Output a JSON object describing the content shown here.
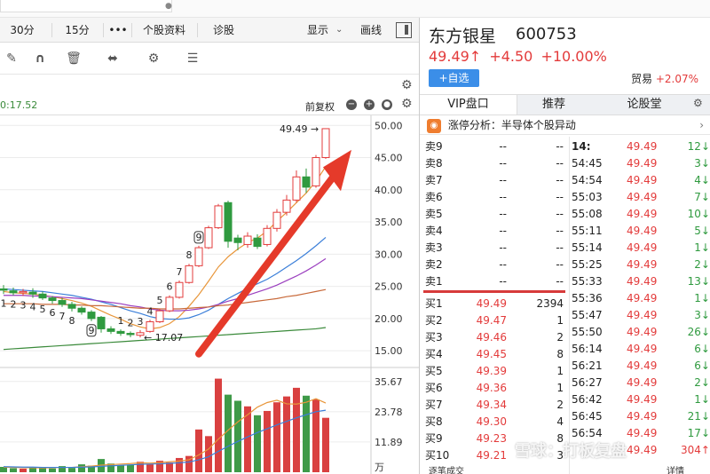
{
  "tabs": [
    "30分",
    "15分",
    "•••",
    "个股资料",
    "诊股",
    "显示",
    "画线"
  ],
  "subbar": {
    "time": "0:17.52",
    "label": "前复权"
  },
  "stock": {
    "name": "东方银星",
    "code": "600753",
    "price": "49.49↑",
    "change": "+4.50",
    "pct": "+10.00%",
    "add_btn": "+自选",
    "trade_label": "贸易",
    "trade_pct": "+2.07%"
  },
  "right_tabs": [
    "VIP盘口",
    "推荐",
    "论股堂"
  ],
  "news": "涨停分析：半导体个股异动",
  "sell_book": [
    {
      "label": "卖9",
      "price": "--",
      "vol": "--"
    },
    {
      "label": "卖8",
      "price": "--",
      "vol": "--"
    },
    {
      "label": "卖7",
      "price": "--",
      "vol": "--"
    },
    {
      "label": "卖6",
      "price": "--",
      "vol": "--"
    },
    {
      "label": "卖5",
      "price": "--",
      "vol": "--"
    },
    {
      "label": "卖4",
      "price": "--",
      "vol": "--"
    },
    {
      "label": "卖3",
      "price": "--",
      "vol": "--"
    },
    {
      "label": "卖2",
      "price": "--",
      "vol": "--"
    },
    {
      "label": "卖1",
      "price": "--",
      "vol": "--"
    }
  ],
  "buy_book": [
    {
      "label": "买1",
      "price": "49.49",
      "vol": "2394"
    },
    {
      "label": "买2",
      "price": "49.47",
      "vol": "1"
    },
    {
      "label": "买3",
      "price": "49.46",
      "vol": "2"
    },
    {
      "label": "买4",
      "price": "49.45",
      "vol": "8"
    },
    {
      "label": "买5",
      "price": "49.39",
      "vol": "1"
    },
    {
      "label": "买6",
      "price": "49.36",
      "vol": "1"
    },
    {
      "label": "买7",
      "price": "49.34",
      "vol": "2"
    },
    {
      "label": "买8",
      "price": "49.30",
      "vol": "4"
    },
    {
      "label": "买9",
      "price": "49.23",
      "vol": "8"
    },
    {
      "label": "买10",
      "price": "49.21",
      "vol": "3"
    }
  ],
  "ticks": [
    {
      "t": "14:",
      "p": "49.49",
      "v": "12↓",
      "c": "green"
    },
    {
      "t": "54:45",
      "p": "49.49",
      "v": "3↓",
      "c": "green"
    },
    {
      "t": "54:54",
      "p": "49.49",
      "v": "4↓",
      "c": "green"
    },
    {
      "t": "55:03",
      "p": "49.49",
      "v": "7↓",
      "c": "green"
    },
    {
      "t": "55:08",
      "p": "49.49",
      "v": "10↓",
      "c": "green"
    },
    {
      "t": "55:11",
      "p": "49.49",
      "v": "5↓",
      "c": "green"
    },
    {
      "t": "55:14",
      "p": "49.49",
      "v": "1↓",
      "c": "green"
    },
    {
      "t": "55:25",
      "p": "49.49",
      "v": "2↓",
      "c": "green"
    },
    {
      "t": "55:33",
      "p": "49.49",
      "v": "13↓",
      "c": "green"
    },
    {
      "t": "55:36",
      "p": "49.49",
      "v": "1↓",
      "c": "green"
    },
    {
      "t": "55:47",
      "p": "49.49",
      "v": "3↓",
      "c": "green"
    },
    {
      "t": "55:50",
      "p": "49.49",
      "v": "26↓",
      "c": "green"
    },
    {
      "t": "56:14",
      "p": "49.49",
      "v": "6↓",
      "c": "green"
    },
    {
      "t": "56:21",
      "p": "49.49",
      "v": "6↓",
      "c": "green"
    },
    {
      "t": "56:27",
      "p": "49.49",
      "v": "2↓",
      "c": "green"
    },
    {
      "t": "56:42",
      "p": "49.49",
      "v": "1↓",
      "c": "green"
    },
    {
      "t": "56:45",
      "p": "49.49",
      "v": "21↓",
      "c": "green"
    },
    {
      "t": "56:54",
      "p": "49.49",
      "v": "17↓",
      "c": "green"
    },
    {
      "t": "",
      "p": "49.49",
      "v": "304↑",
      "c": "red"
    }
  ],
  "foot": {
    "left": "逐笔成交",
    "right": "详情"
  },
  "watermark": "雪球：打板复盘",
  "chart_data": {
    "type": "candlestick",
    "y_ticks": [
      50,
      45,
      40,
      35,
      30,
      25,
      20,
      15
    ],
    "ylim": [
      13.5,
      51
    ],
    "vol_ticks": [
      "35.67",
      "23.78",
      "11.89"
    ],
    "vol_unit": "万",
    "high_label": "49.49",
    "low_label": "17.07",
    "candles": [
      {
        "o": 24.6,
        "c": 24.4,
        "h": 25.2,
        "l": 23.8
      },
      {
        "o": 24.3,
        "c": 24.0,
        "h": 24.8,
        "l": 23.6
      },
      {
        "o": 24.0,
        "c": 24.2,
        "h": 24.6,
        "l": 23.5
      },
      {
        "o": 24.1,
        "c": 23.8,
        "h": 24.7,
        "l": 23.2
      },
      {
        "o": 23.8,
        "c": 23.2,
        "h": 24.2,
        "l": 22.9
      },
      {
        "o": 23.2,
        "c": 22.8,
        "h": 23.5,
        "l": 22.3
      },
      {
        "o": 22.8,
        "c": 22.2,
        "h": 23.2,
        "l": 21.8
      },
      {
        "o": 22.2,
        "c": 21.6,
        "h": 22.6,
        "l": 21.1
      },
      {
        "o": 21.6,
        "c": 21.0,
        "h": 21.9,
        "l": 20.6
      },
      {
        "o": 21.0,
        "c": 20.0,
        "h": 21.3,
        "l": 19.6
      },
      {
        "o": 20.2,
        "c": 18.4,
        "h": 20.4,
        "l": 17.8
      },
      {
        "o": 18.4,
        "c": 18.0,
        "h": 18.8,
        "l": 17.6
      },
      {
        "o": 18.0,
        "c": 17.7,
        "h": 18.3,
        "l": 17.3
      },
      {
        "o": 17.7,
        "c": 17.5,
        "h": 18.0,
        "l": 17.1
      },
      {
        "o": 17.4,
        "c": 17.8,
        "h": 18.2,
        "l": 17.07
      },
      {
        "o": 18.0,
        "c": 19.5,
        "h": 19.8,
        "l": 17.8
      },
      {
        "o": 19.5,
        "c": 21.2,
        "h": 21.5,
        "l": 19.3
      },
      {
        "o": 21.2,
        "c": 23.3,
        "h": 23.6,
        "l": 21.0
      },
      {
        "o": 23.3,
        "c": 25.6,
        "h": 25.9,
        "l": 23.1
      },
      {
        "o": 25.6,
        "c": 28.2,
        "h": 28.5,
        "l": 25.4
      },
      {
        "o": 28.2,
        "c": 31.0,
        "h": 31.3,
        "l": 28.0
      },
      {
        "o": 31.0,
        "c": 34.1,
        "h": 34.4,
        "l": 30.8
      },
      {
        "o": 34.1,
        "c": 37.5,
        "h": 37.8,
        "l": 33.9
      },
      {
        "o": 38.0,
        "c": 32.0,
        "h": 38.3,
        "l": 31.0
      },
      {
        "o": 32.5,
        "c": 31.8,
        "h": 33.0,
        "l": 30.6
      },
      {
        "o": 31.5,
        "c": 32.8,
        "h": 33.4,
        "l": 31.0
      },
      {
        "o": 32.5,
        "c": 31.2,
        "h": 33.1,
        "l": 30.8
      },
      {
        "o": 31.5,
        "c": 34.0,
        "h": 34.5,
        "l": 31.2
      },
      {
        "o": 34.0,
        "c": 36.5,
        "h": 37.0,
        "l": 33.5
      },
      {
        "o": 36.5,
        "c": 38.4,
        "h": 39.2,
        "l": 36.0
      },
      {
        "o": 38.4,
        "c": 42.0,
        "h": 43.0,
        "l": 38.0
      },
      {
        "o": 42.0,
        "c": 40.4,
        "h": 43.3,
        "l": 39.5
      },
      {
        "o": 40.6,
        "c": 45.0,
        "h": 45.4,
        "l": 40.3
      },
      {
        "o": 45.0,
        "c": 49.49,
        "h": 49.49,
        "l": 44.8
      }
    ],
    "ma_series": [
      {
        "color": "#e8963a",
        "values": [
          24.2,
          24.0,
          23.9,
          23.8,
          23.6,
          23.4,
          23.1,
          22.8,
          22.4,
          21.9,
          21.2,
          20.5,
          19.9,
          19.2,
          18.7,
          18.4,
          18.6,
          19.2,
          20.3,
          21.9,
          23.7,
          25.8,
          28.0,
          29.6,
          30.8,
          31.8,
          32.5,
          33.6,
          35.1,
          36.5,
          38.0,
          39.5,
          41.3,
          43.6
        ]
      },
      {
        "color": "#3b7fd9",
        "values": [
          24.6,
          24.5,
          24.4,
          24.3,
          24.2,
          24.0,
          23.8,
          23.6,
          23.3,
          23.0,
          22.6,
          22.2,
          21.7,
          21.2,
          20.8,
          20.3,
          20.0,
          19.9,
          19.9,
          20.1,
          20.6,
          21.3,
          22.2,
          23.1,
          23.9,
          24.7,
          25.4,
          26.1,
          27.0,
          28.0,
          29.0,
          30.1,
          31.3,
          32.6
        ]
      },
      {
        "color": "#9b3fbf",
        "values": [
          23.6,
          23.6,
          23.6,
          23.5,
          23.5,
          23.4,
          23.3,
          23.2,
          23.1,
          22.9,
          22.7,
          22.5,
          22.3,
          22.0,
          21.8,
          21.5,
          21.3,
          21.2,
          21.2,
          21.3,
          21.5,
          21.8,
          22.2,
          22.7,
          23.1,
          23.6,
          24.1,
          24.6,
          25.2,
          25.9,
          26.6,
          27.4,
          28.3,
          29.3
        ]
      },
      {
        "color": "#c8693a",
        "values": [
          22.3,
          22.3,
          22.3,
          22.3,
          22.2,
          22.2,
          22.2,
          22.1,
          22.1,
          22.0,
          22.0,
          21.9,
          21.8,
          21.7,
          21.6,
          21.6,
          21.5,
          21.5,
          21.5,
          21.6,
          21.7,
          21.8,
          22.0,
          22.1,
          22.3,
          22.5,
          22.7,
          22.9,
          23.1,
          23.4,
          23.6,
          23.9,
          24.2,
          24.5
        ]
      },
      {
        "color": "#3a8a3a",
        "values": [
          15.2,
          15.3,
          15.4,
          15.5,
          15.6,
          15.7,
          15.8,
          15.9,
          16.0,
          16.1,
          16.2,
          16.3,
          16.4,
          16.5,
          16.6,
          16.7,
          16.8,
          16.9,
          17.0,
          17.1,
          17.2,
          17.3,
          17.4,
          17.5,
          17.6,
          17.7,
          17.8,
          17.9,
          18.0,
          18.1,
          18.2,
          18.3,
          18.4,
          18.6
        ]
      }
    ],
    "seq_labels": [
      {
        "i": 0,
        "t": "1",
        "pos": "below"
      },
      {
        "i": 1,
        "t": "2",
        "pos": "below"
      },
      {
        "i": 2,
        "t": "3",
        "pos": "below"
      },
      {
        "i": 3,
        "t": "4",
        "pos": "below"
      },
      {
        "i": 4,
        "t": "5",
        "pos": "below"
      },
      {
        "i": 5,
        "t": "6",
        "pos": "below"
      },
      {
        "i": 6,
        "t": "7",
        "pos": "below"
      },
      {
        "i": 7,
        "t": "8",
        "pos": "below"
      },
      {
        "i": 9,
        "t": "9",
        "pos": "below",
        "boxed": true
      },
      {
        "i": 12,
        "t": "1",
        "pos": "above"
      },
      {
        "i": 13,
        "t": "2",
        "pos": "above"
      },
      {
        "i": 14,
        "t": "3",
        "pos": "above"
      },
      {
        "i": 15,
        "t": "4",
        "pos": "above"
      },
      {
        "i": 16,
        "t": "5",
        "pos": "above"
      },
      {
        "i": 17,
        "t": "6",
        "pos": "above"
      },
      {
        "i": 18,
        "t": "7",
        "pos": "above"
      },
      {
        "i": 19,
        "t": "8",
        "pos": "above"
      },
      {
        "i": 20,
        "t": "9",
        "pos": "above",
        "boxed": true
      }
    ],
    "volumes": [
      2.1,
      1.6,
      1.4,
      2.0,
      1.8,
      1.5,
      2.4,
      1.7,
      3.1,
      2.6,
      5.2,
      3.4,
      2.8,
      3.0,
      4.1,
      3.3,
      4.5,
      3.8,
      5.6,
      6.4,
      16.8,
      14.2,
      36.8,
      30.5,
      28.1,
      25.9,
      22.4,
      24.1,
      27.5,
      29.8,
      33.2,
      30.1,
      28.6,
      21.4
    ],
    "vol_ylim": [
      0,
      37
    ],
    "vol_ma": [
      {
        "color": "#e8963a",
        "values": [
          2.0,
          1.9,
          1.8,
          1.8,
          1.7,
          1.8,
          1.9,
          1.9,
          2.2,
          2.4,
          2.8,
          3.0,
          3.2,
          3.4,
          3.7,
          3.6,
          3.8,
          4.1,
          4.4,
          4.9,
          6.8,
          9.1,
          13.0,
          16.5,
          19.8,
          22.6,
          25.6,
          27.4,
          28.3,
          26.9,
          26.8,
          27.5,
          28.9,
          27.2
        ]
      },
      {
        "color": "#3b7fd9",
        "values": [
          2.2,
          2.1,
          2.0,
          2.0,
          1.9,
          1.9,
          1.9,
          1.9,
          2.0,
          2.1,
          2.3,
          2.5,
          2.7,
          2.9,
          3.1,
          3.2,
          3.3,
          3.5,
          3.7,
          4.0,
          4.9,
          6.1,
          8.2,
          10.2,
          12.1,
          13.9,
          15.6,
          17.1,
          18.6,
          20.0,
          21.4,
          22.6,
          23.8,
          24.4
        ]
      }
    ]
  }
}
